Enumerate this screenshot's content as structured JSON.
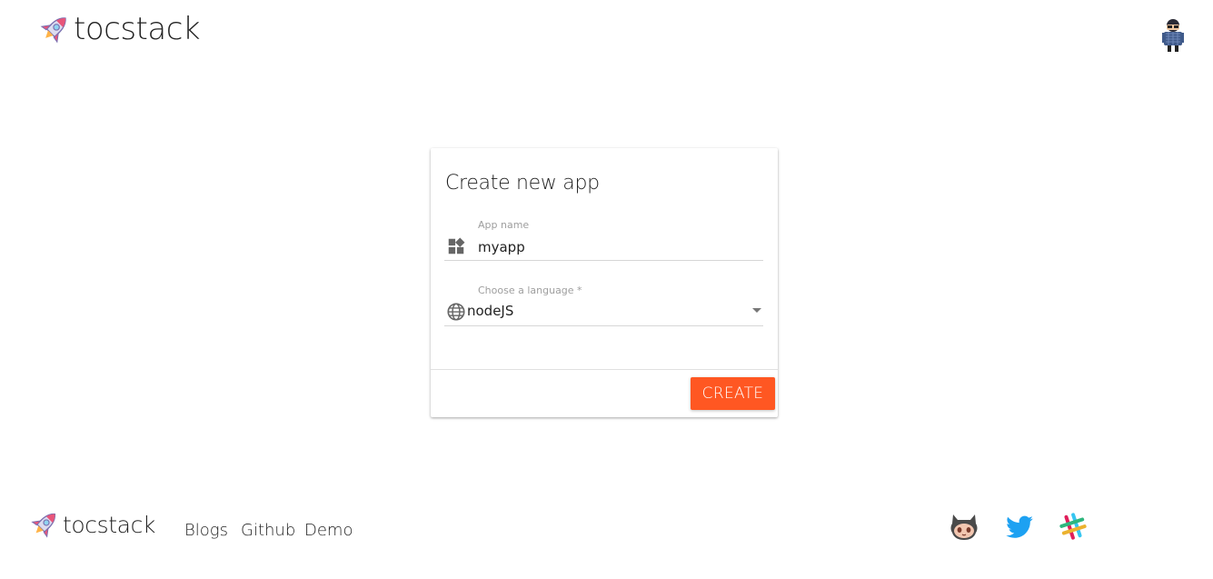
{
  "header": {
    "brand_name": "tocstack",
    "logo_icon": "rocket-icon",
    "avatar_icon": "avatar-icon"
  },
  "card": {
    "title": "Create new app",
    "app_name": {
      "label": "App name",
      "value": "myapp",
      "icon": "widgets-icon"
    },
    "language": {
      "label": "Choose a language *",
      "value": "nodeJS",
      "icon": "globe-icon",
      "dropdown_icon": "caret-down-icon"
    },
    "create_label": "CREATE"
  },
  "footer": {
    "brand_name": "tocstack",
    "links": [
      "Blogs",
      "Github",
      "Demo"
    ],
    "social": [
      "github-octocat-icon",
      "twitter-icon",
      "slack-icon"
    ]
  },
  "colors": {
    "accent": "#ff5722",
    "text": "#222222",
    "label": "#9e9e9e",
    "twitter": "#1da1f2"
  }
}
